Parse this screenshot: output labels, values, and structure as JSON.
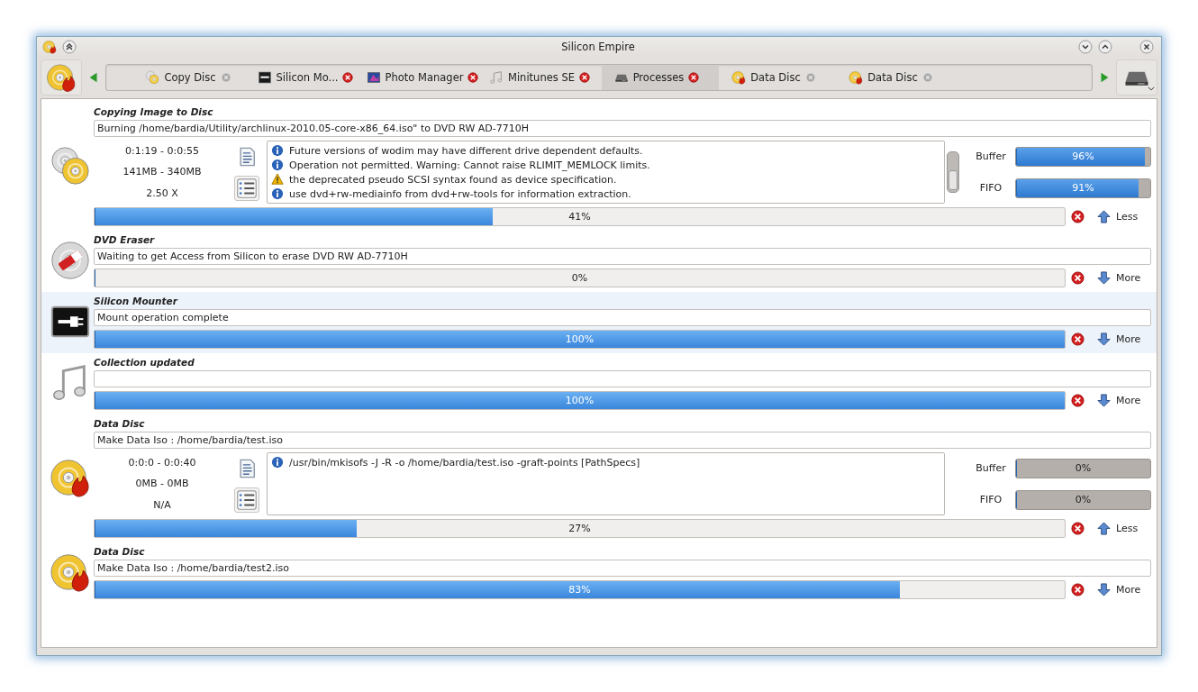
{
  "window": {
    "title": "Silicon Empire"
  },
  "tabs": [
    {
      "label": "Copy Disc",
      "kind": "disc-copy",
      "selected": false,
      "close_enabled": false
    },
    {
      "label": "Silicon Mo...",
      "kind": "terminal",
      "selected": false,
      "close_enabled": true
    },
    {
      "label": "Photo Manager",
      "kind": "photo",
      "selected": false,
      "close_enabled": true
    },
    {
      "label": "Minitunes SE",
      "kind": "music",
      "selected": false,
      "close_enabled": true
    },
    {
      "label": "Processes",
      "kind": "drive",
      "selected": true,
      "close_enabled": true
    },
    {
      "label": "Data Disc",
      "kind": "disc-burn",
      "selected": false,
      "close_enabled": false
    },
    {
      "label": "Data Disc",
      "kind": "disc-burn",
      "selected": false,
      "close_enabled": false
    }
  ],
  "processes": [
    {
      "title": "Copying Image to Disc",
      "kind": "disc-copy",
      "status": "Burning /home/bardia/Utility/archlinux-2010.05-core-x86_64.iso\" to DVD RW AD-7710H",
      "stats": [
        "0:1:19 - 0:0:55",
        "141MB - 340MB",
        "2.50 X"
      ],
      "log": [
        {
          "kind": "info",
          "text": "Future versions of wodim may have different drive dependent defaults."
        },
        {
          "kind": "info",
          "text": "Operation not permitted. Warning: Cannot raise RLIMIT_MEMLOCK limits."
        },
        {
          "kind": "warning",
          "text": "the deprecated pseudo SCSI syntax found as device specification."
        },
        {
          "kind": "info",
          "text": "use dvd+rw-mediainfo from dvd+rw-tools for information extraction."
        }
      ],
      "buffers": [
        {
          "label": "Buffer",
          "level": 0.96,
          "reading": "96%"
        },
        {
          "label": "FIFO",
          "level": 0.91,
          "reading": "91%"
        }
      ],
      "level": 0.41,
      "reading": "41%",
      "expanded": true,
      "toggle": "Less",
      "hovered": false
    },
    {
      "title": "DVD Eraser",
      "kind": "eraser",
      "status": "Waiting to get Access from Silicon to erase DVD RW AD-7710H",
      "level": 0,
      "reading": "0%",
      "expanded": false,
      "toggle": "More",
      "hovered": false
    },
    {
      "title": "Silicon Mounter",
      "kind": "mount",
      "status": "Mount operation complete",
      "level": 1,
      "reading": "100%",
      "expanded": false,
      "toggle": "More",
      "hovered": true
    },
    {
      "title": "Collection updated",
      "kind": "music",
      "level": 1,
      "reading": "100%",
      "expanded": false,
      "toggle": "More",
      "hovered": false
    },
    {
      "title": "Data Disc",
      "kind": "disc-burn",
      "status": "Make Data Iso : /home/bardia/test.iso",
      "stats": [
        "0:0:0 - 0:0:40",
        "0MB - 0MB",
        "N/A"
      ],
      "log": [
        {
          "kind": "info",
          "text": "/usr/bin/mkisofs -J -R -o /home/bardia/test.iso -graft-points [PathSpecs]"
        }
      ],
      "buffers": [
        {
          "label": "Buffer",
          "level": 0,
          "reading": "0%"
        },
        {
          "label": "FIFO",
          "level": 0,
          "reading": "0%"
        }
      ],
      "level": 0.27,
      "reading": "27%",
      "expanded": true,
      "toggle": "Less",
      "hovered": false
    },
    {
      "title": "Data Disc",
      "kind": "disc-burn",
      "status": "Make Data Iso : /home/bardia/test2.iso",
      "level": 0.83,
      "reading": "83%",
      "expanded": false,
      "toggle": "More",
      "hovered": false
    }
  ]
}
